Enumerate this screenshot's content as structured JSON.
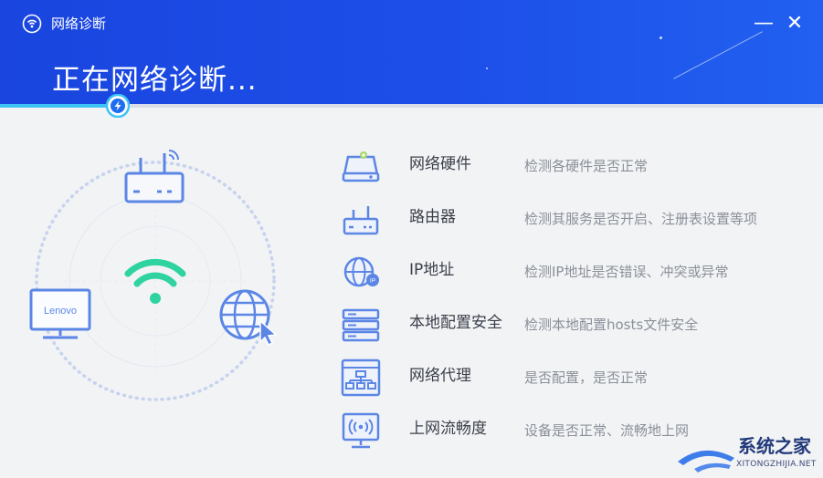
{
  "window": {
    "title": "网络诊断",
    "minimize_glyph": "—",
    "close_glyph": "✕"
  },
  "header": {
    "status_title": "正在网络诊断..."
  },
  "progress": {
    "fraction": 0.14
  },
  "illustration": {
    "monitor_brand": "Lenovo",
    "icons": [
      "router-icon",
      "wifi-icon",
      "monitor-icon",
      "globe-cursor-icon"
    ]
  },
  "diagnostics": [
    {
      "icon": "hardware-drive-icon",
      "name": "网络硬件",
      "desc": "检测各硬件是否正常"
    },
    {
      "icon": "router-icon",
      "name": "路由器",
      "desc": "检测其服务是否开启、注册表设置等项"
    },
    {
      "icon": "globe-ip-icon",
      "name": "IP地址",
      "desc": "检测IP地址是否错误、冲突或异常"
    },
    {
      "icon": "server-stack-icon",
      "name": "本地配置安全",
      "desc": "检测本地配置hosts文件安全"
    },
    {
      "icon": "network-proxy-icon",
      "name": "网络代理",
      "desc": "是否配置，是否正常"
    },
    {
      "icon": "monitor-signal-icon",
      "name": "上网流畅度",
      "desc": "设备是否正常、流畅地上网"
    }
  ],
  "watermark": {
    "title": "系统之家",
    "subtitle": "XITONGZHIJIA.NET"
  },
  "colors": {
    "header": "#1d4fe8",
    "accent": "#3cc4f5",
    "icon_blue": "#5b86e5",
    "wifi_green": "#2ed3a0"
  }
}
